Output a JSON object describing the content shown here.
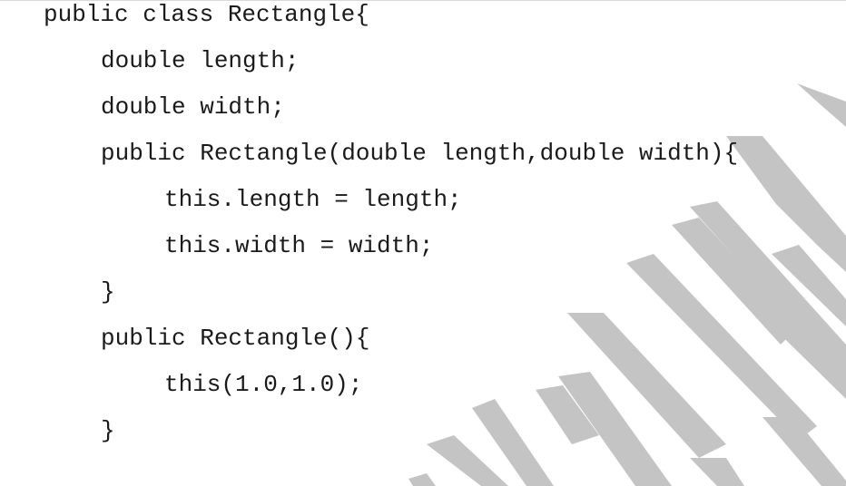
{
  "code": {
    "lines": [
      "public class Rectangle{",
      "double length;",
      "double width;",
      "public Rectangle(double length,double width){",
      "this.length = length;",
      "this.width = width;",
      "}",
      "public Rectangle(){",
      "this(1.0,1.0);",
      "}"
    ]
  },
  "watermark": {
    "color": "#c4c4c4"
  }
}
